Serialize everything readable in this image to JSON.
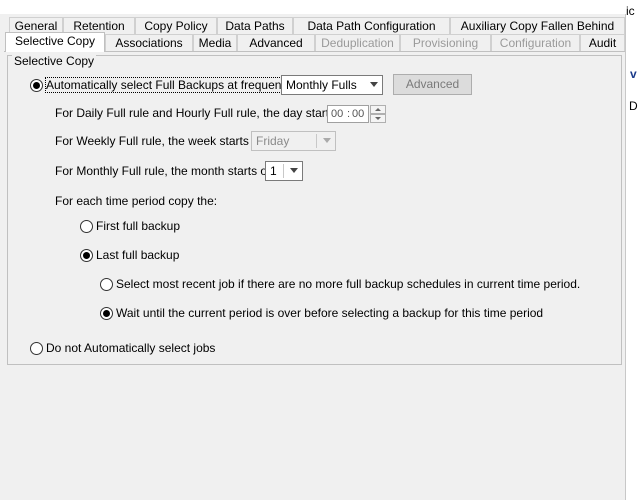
{
  "right_edge": {
    "char1": "ic",
    "char2": "v",
    "char3": "D"
  },
  "tabs_back": [
    "General",
    "Retention",
    "Copy Policy",
    "Data Paths",
    "Data Path Configuration",
    "Auxiliary Copy Fallen Behind"
  ],
  "tabs_front": [
    "Selective Copy",
    "Associations",
    "Media",
    "Advanced",
    "Deduplication",
    "Provisioning",
    "Configuration",
    "Audit"
  ],
  "group": {
    "title": "Selective Copy"
  },
  "auto_select": {
    "label": "Automatically select Full Backups at frequency",
    "frequency_value": "Monthly Fulls",
    "advanced_button": "Advanced"
  },
  "daily_rule": {
    "label": "For Daily Full rule and Hourly Full rule, the day starts on",
    "hours": "00",
    "sep": ":",
    "minutes": "00"
  },
  "weekly_rule": {
    "label": "For Weekly Full rule, the week starts on",
    "value": "Friday"
  },
  "monthly_rule": {
    "label": "For Monthly Full rule, the month starts on",
    "value": "1"
  },
  "copy_section": {
    "label": "For each time period copy the:",
    "first_full": "First full backup",
    "last_full": "Last full backup",
    "most_recent": "Select most recent job if there are no more full backup schedules in current time period.",
    "wait_until": "Wait until the current period is over before selecting a backup for this time period"
  },
  "do_not_auto": {
    "label": "Do not Automatically select jobs"
  }
}
